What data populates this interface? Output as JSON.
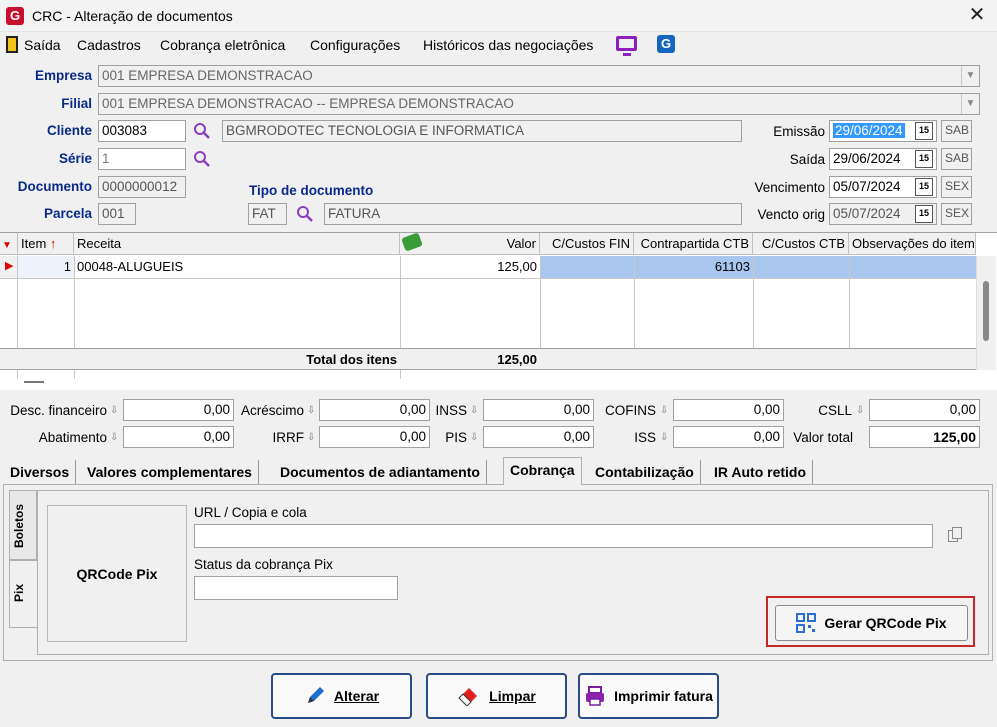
{
  "window": {
    "title": "CRC - Alteração de documentos",
    "close": "✕"
  },
  "menu": {
    "items": [
      "Saída",
      "Cadastros",
      "Cobrança eletrônica",
      "Configurações",
      "Históricos das negociações"
    ]
  },
  "form": {
    "empresa_label": "Empresa",
    "empresa_value": "001 EMPRESA DEMONSTRACAO",
    "filial_label": "Filial",
    "filial_value": "001 EMPRESA DEMONSTRACAO -- EMPRESA DEMONSTRACAO",
    "cliente_label": "Cliente",
    "cliente_code": "003083",
    "cliente_name": "BGMRODOTEC TECNOLOGIA  E INFORMATICA",
    "serie_label": "Série",
    "serie_value": "1",
    "documento_label": "Documento",
    "documento_value": "0000000012",
    "parcela_label": "Parcela",
    "parcela_value": "001",
    "tipo_label": "Tipo de documento",
    "tipo_code": "FAT",
    "tipo_name": "FATURA",
    "emissao_label": "Emissão",
    "emissao_value": "29/06/2024",
    "emissao_day": "SAB",
    "saida_label": "Saída",
    "saida_value": "29/06/2024",
    "saida_day": "SAB",
    "vencimento_label": "Vencimento",
    "vencimento_value": "05/07/2024",
    "vencimento_day": "SEX",
    "vencto_orig_label": "Vencto orig",
    "vencto_orig_value": "05/07/2024",
    "vencto_orig_day": "SEX",
    "cal_icon": "15"
  },
  "grid": {
    "headers": {
      "item": "Item",
      "receita": "Receita",
      "valor": "Valor",
      "custos_fin": "C/Custos FIN",
      "contrapartida": "Contrapartida CTB",
      "custos_ctb": "C/Custos CTB",
      "obs": "Observações do item"
    },
    "rows": [
      {
        "item": "1",
        "receita": "00048-ALUGUEIS",
        "valor": "125,00",
        "custos_fin": "",
        "contrapartida": "61103",
        "custos_ctb": "",
        "obs": ""
      }
    ],
    "total_label": "Total dos itens",
    "total_value": "125,00"
  },
  "totals": {
    "desc_fin_label": "Desc. financeiro",
    "desc_fin": "0,00",
    "acrescimo_label": "Acréscimo",
    "acrescimo": "0,00",
    "inss_label": "INSS",
    "inss": "0,00",
    "cofins_label": "COFINS",
    "cofins": "0,00",
    "csll_label": "CSLL",
    "csll": "0,00",
    "abatimento_label": "Abatimento",
    "abatimento": "0,00",
    "irrf_label": "IRRF",
    "irrf": "0,00",
    "pis_label": "PIS",
    "pis": "0,00",
    "iss_label": "ISS",
    "iss": "0,00",
    "valor_total_label": "Valor total",
    "valor_total": "125,00"
  },
  "tabs": [
    "Diversos",
    "Valores complementares",
    "Documentos de adiantamento",
    "Cobrança",
    "Contabilização",
    "IR Auto retido"
  ],
  "cobranca": {
    "vtabs": [
      "Boletos",
      "Pix"
    ],
    "qrcode_label": "QRCode Pix",
    "url_label": "URL / Copia e cola",
    "url_value": "",
    "status_label": "Status da cobrança Pix",
    "status_value": "",
    "gerar_button": "Gerar QRCode Pix"
  },
  "actions": {
    "alterar": "Alterar",
    "limpar": "Limpar",
    "imprimir": "Imprimir fatura"
  }
}
